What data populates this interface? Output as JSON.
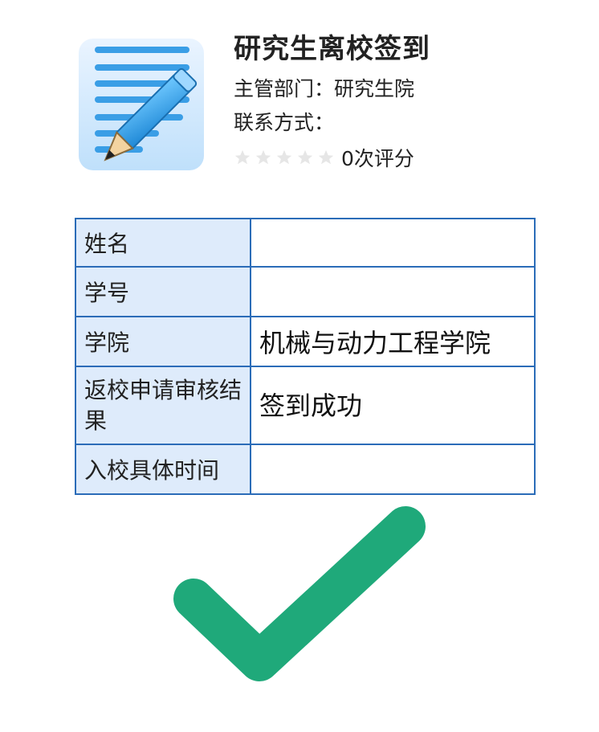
{
  "header": {
    "title": "研究生离校签到",
    "department_label": "主管部门：",
    "department_value": "研究生院",
    "contact_label": "联系方式：",
    "contact_value": "",
    "rating_text": "0次评分",
    "rating_stars": 0,
    "rating_max": 5,
    "app_icon": "document-pencil-icon"
  },
  "table": {
    "rows": [
      {
        "label": "姓名",
        "value": ""
      },
      {
        "label": "学号",
        "value": ""
      },
      {
        "label": "学院",
        "value": "机械与动力工程学院"
      },
      {
        "label": "返校申请审核结果",
        "value": "签到成功"
      },
      {
        "label": "入校具体时间",
        "value": ""
      }
    ]
  },
  "status_icon": "check-icon",
  "colors": {
    "table_border": "#2b6cb8",
    "label_bg": "#deebfb",
    "check": "#1fa97a",
    "star_empty": "#e6e6e6"
  }
}
